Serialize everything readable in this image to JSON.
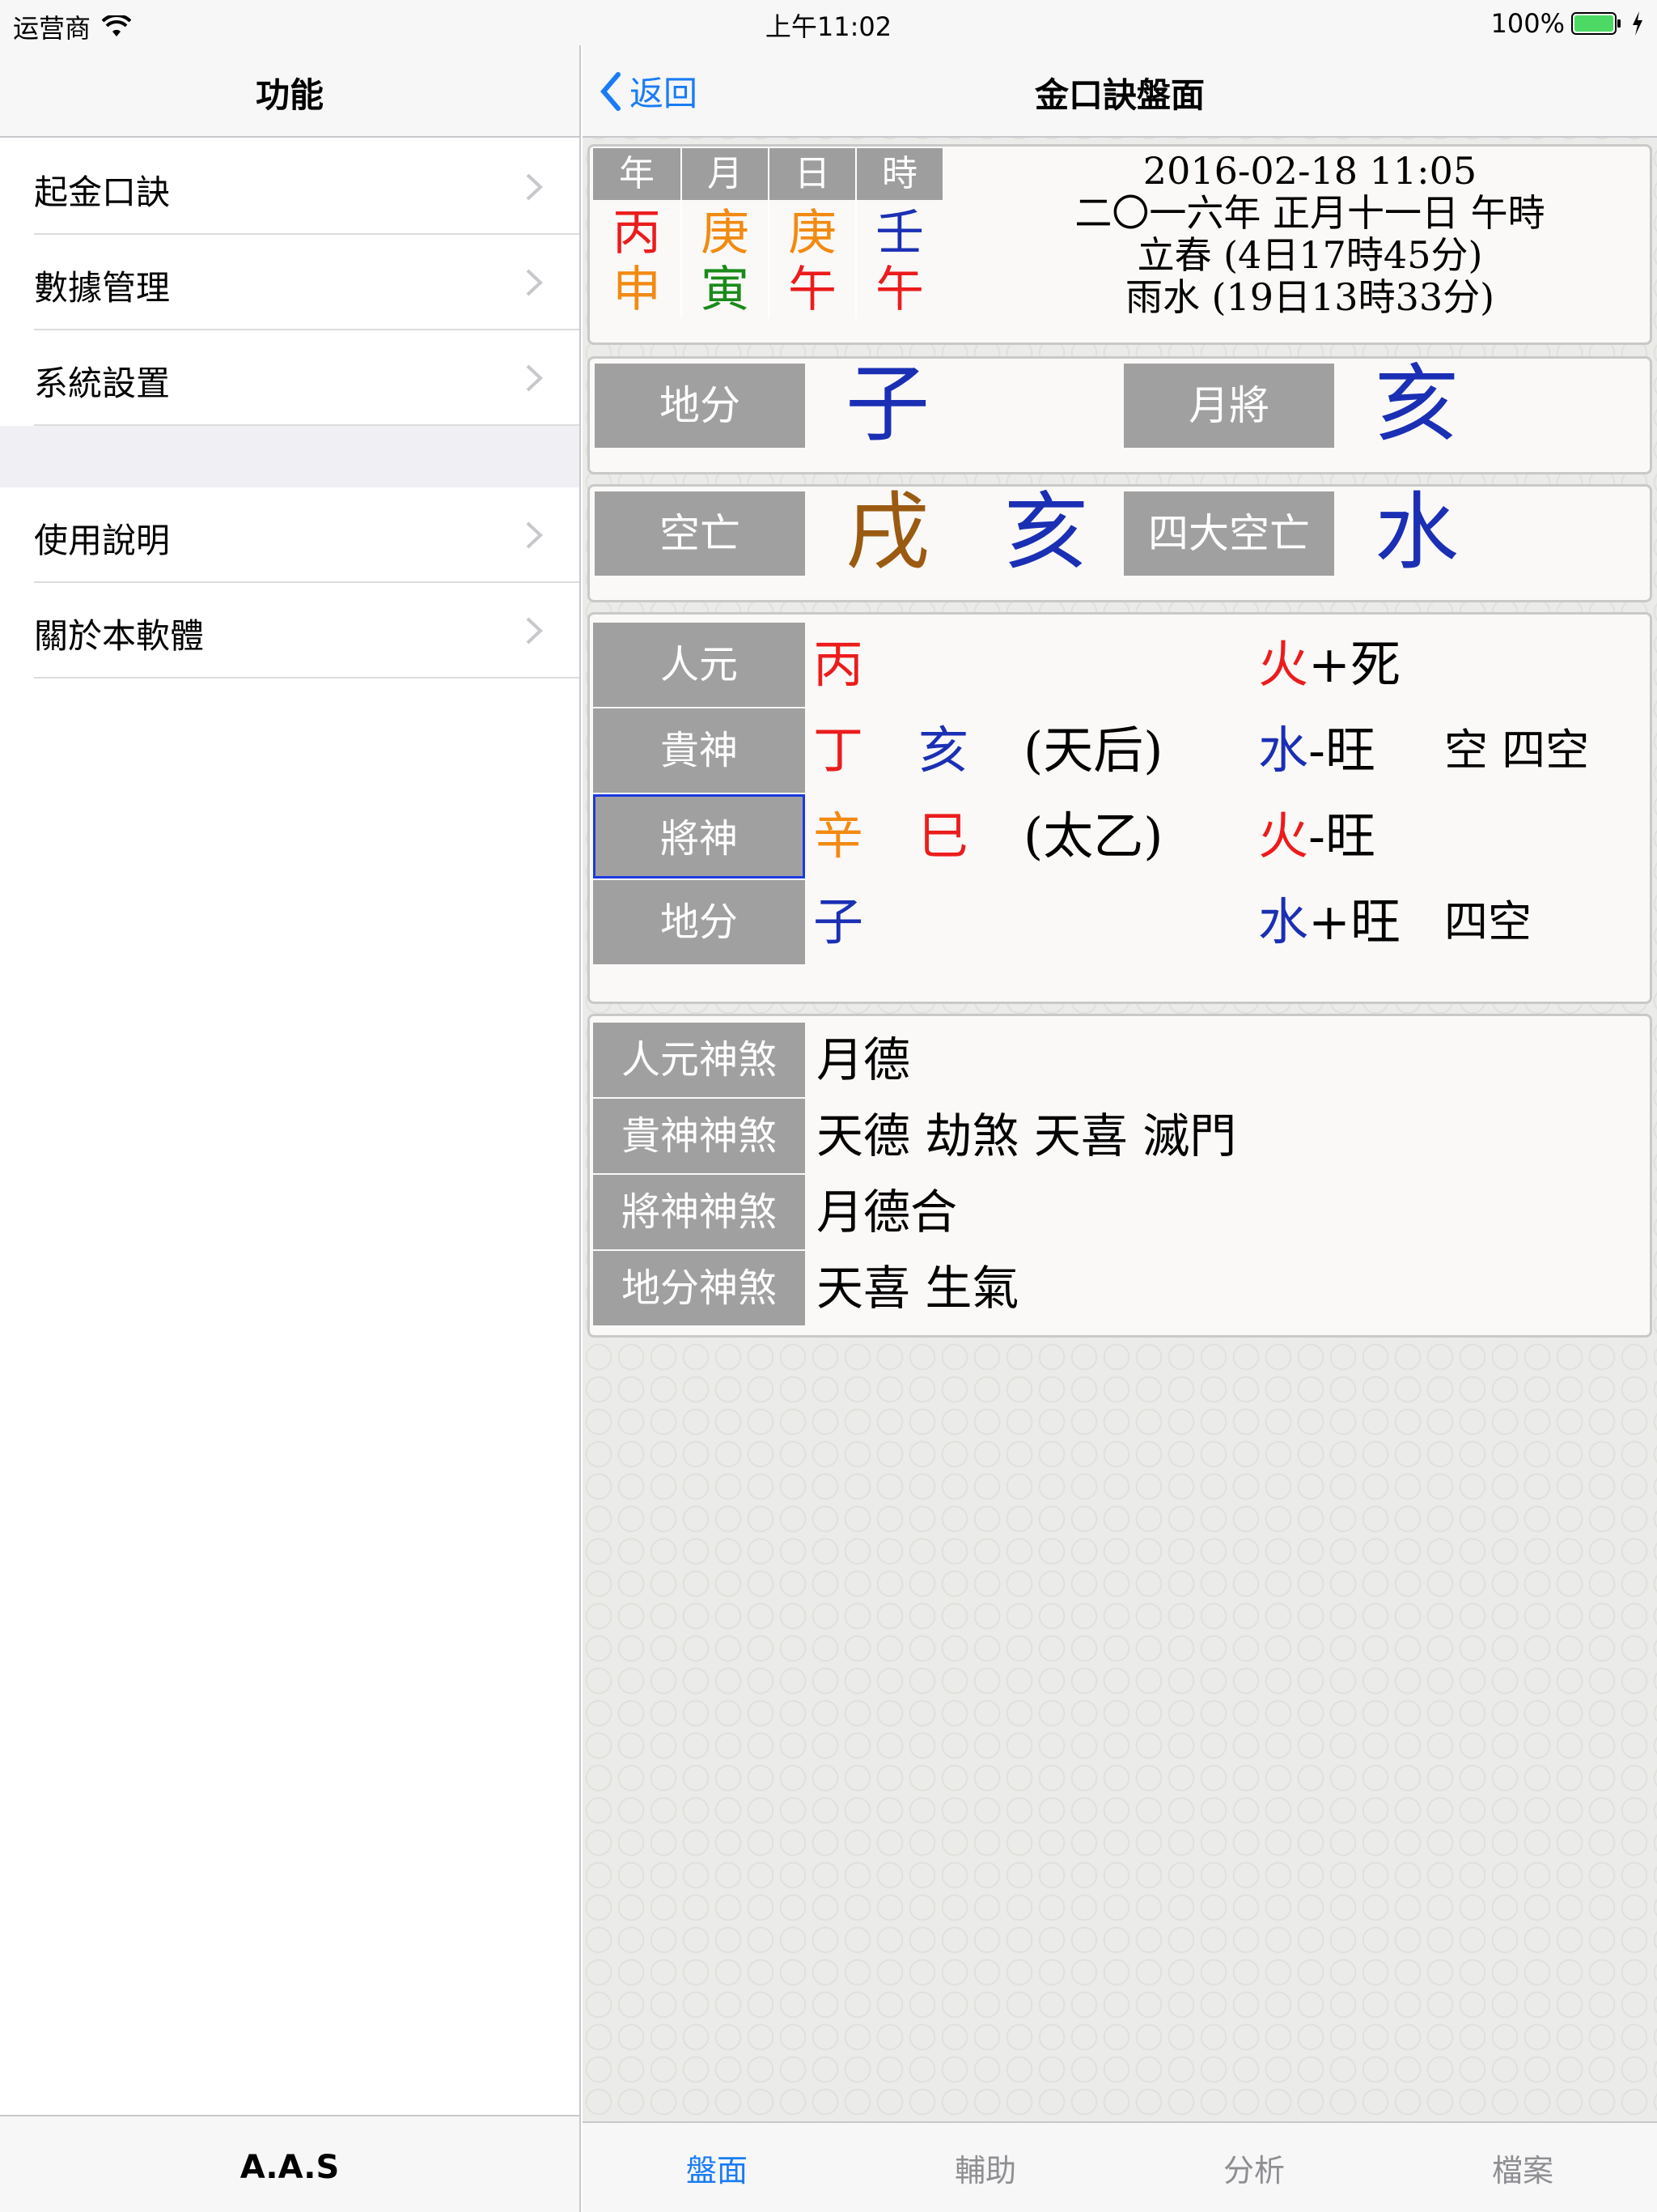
{
  "status": {
    "carrier": "运营商",
    "time": "上午11:02",
    "battery": "100%"
  },
  "master": {
    "title": "功能",
    "group1": [
      {
        "label": "起金口訣"
      },
      {
        "label": "數據管理"
      },
      {
        "label": "系統設置"
      }
    ],
    "group2": [
      {
        "label": "使用說明"
      },
      {
        "label": "關於本軟體"
      }
    ],
    "footer": "A.A.S"
  },
  "detail": {
    "back_label": "返回",
    "title": "金口訣盤面",
    "pillars": [
      {
        "head": "年",
        "stem": "丙",
        "branch": "申"
      },
      {
        "head": "月",
        "stem": "庚",
        "branch": "寅"
      },
      {
        "head": "日",
        "stem": "庚",
        "branch": "午"
      },
      {
        "head": "時",
        "stem": "壬",
        "branch": "午"
      }
    ],
    "date_lines": [
      "2016-02-18 11:05",
      "二〇一六年 正月十一日 午時",
      "立春 (4日17時45分)",
      "雨水 (19日13時33分)"
    ],
    "difen": {
      "label": "地分",
      "value": "子"
    },
    "yuejiang": {
      "label": "月將",
      "value": "亥"
    },
    "kongwang": {
      "label": "空亡",
      "values": [
        "戌",
        "亥"
      ]
    },
    "sida_kongwang": {
      "label": "四大空亡",
      "value": "水"
    },
    "table": [
      {
        "label": "人元",
        "c1": "丙",
        "c2": "",
        "c3": "",
        "element": "火",
        "sign": "+",
        "state": "死",
        "note": ""
      },
      {
        "label": "貴神",
        "c1": "丁",
        "c2": "亥",
        "c3": "(天后)",
        "element": "水",
        "sign": "-",
        "state": "旺",
        "note": "空 四空"
      },
      {
        "label": "將神",
        "c1": "辛",
        "c2": "巳",
        "c3": "(太乙)",
        "element": "火",
        "sign": "-",
        "state": "旺",
        "note": ""
      },
      {
        "label": "地分",
        "c1": "子",
        "c2": "",
        "c3": "",
        "element": "水",
        "sign": "+",
        "state": "旺",
        "note": "四空"
      }
    ],
    "shensha": [
      {
        "label": "人元神煞",
        "value": "月德"
      },
      {
        "label": "貴神神煞",
        "value": "天德 劫煞 天喜 滅門"
      },
      {
        "label": "將神神煞",
        "value": "月德合"
      },
      {
        "label": "地分神煞",
        "value": "天喜 生氣"
      }
    ],
    "tabs": [
      "盤面",
      "輔助",
      "分析",
      "檔案"
    ],
    "active_tab": "盤面"
  },
  "colors": {
    "accent": "#1a7cf5",
    "red": "#ec1c1c",
    "orange": "#f28a12",
    "blue": "#1b2fb5",
    "green": "#1a8a1a",
    "brown": "#9b5a12"
  }
}
